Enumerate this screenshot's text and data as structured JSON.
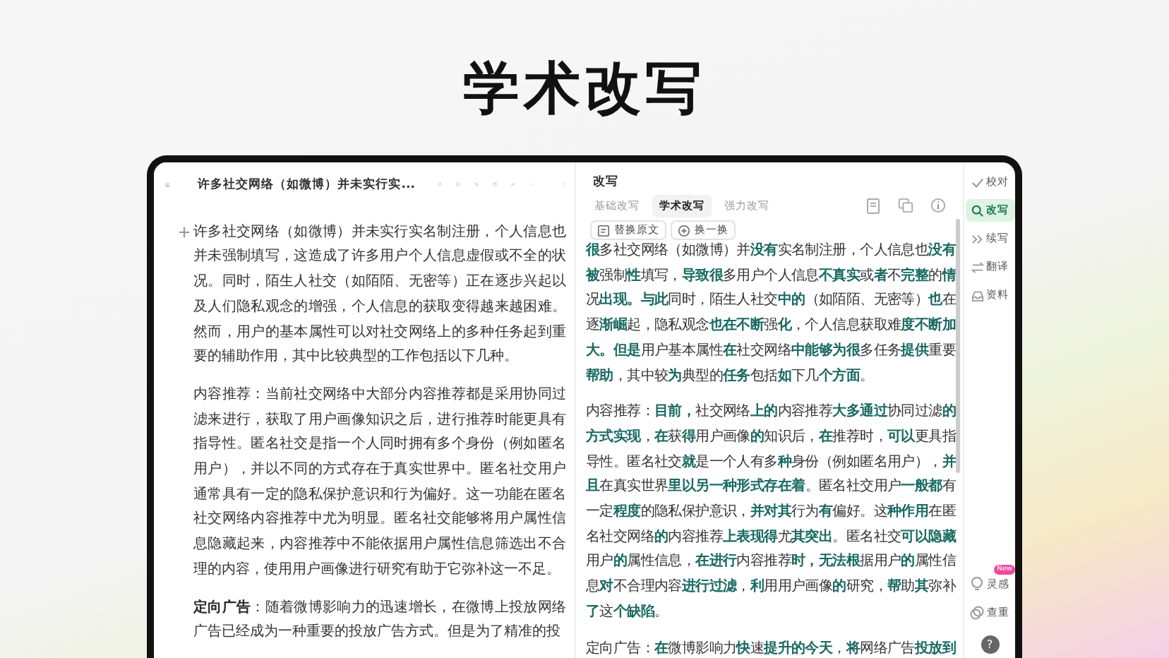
{
  "headline": "学术改写",
  "editor": {
    "doc_title": "许多社交网络（如微博）并未实行实...",
    "paragraphs": [
      "许多社交网络（如微博）并未实行实名制注册，个人信息也并未强制填写，这造成了许多用户个人信息虚假或不全的状况。同时，陌生人社交（如陌陌、无密等）正在逐步兴起以及人们隐私观念的增强，个人信息的获取变得越来越困难。然而，用户的基本属性可以对社交网络上的多种任务起到重要的辅助作用，其中比较典型的工作包括以下几种。",
      "内容推荐：当前社交网络中大部分内容推荐都是采用协同过滤来进行，获取了用户画像知识之后，进行推荐时能更具有指导性。匿名社交是指一个人同时拥有多个身份（例如匿名用户），并以不同的方式存在于真实世界中。匿名社交用户通常具有一定的隐私保护意识和行为偏好。这一功能在匿名社交网络内容推荐中尤为明显。匿名社交能够将用户属性信息隐藏起来，内容推荐中不能依据用户属性信息筛选出不合理的内容，使用用户画像进行研究有助于它弥补这一不足。",
      "**定向广告**：随着微博影响力的迅速增长，在微博上投放网络广告已经成为一种重要的投放广告方式。但是为了精准的投"
    ]
  },
  "rewrite": {
    "title": "改写",
    "tabs": [
      {
        "label": "基础改写",
        "selected": false
      },
      {
        "label": "学术改写",
        "selected": true
      },
      {
        "label": "强力改写",
        "selected": false
      }
    ],
    "actions": [
      "替换原文",
      "换一换"
    ],
    "paragraphs": [
      "**很**多社交网络（如微博）并**没有**实名制注册，个人信息也**没有被**强制**性**填写，**导致很**多用户个人信息**不真实**或**者**不**完整**的**情**况**出现。与此**同时，陌生人社交**中的**（如陌陌、无密等）**也**在逐**渐崛**起，隐私观念**也在不断**强**化**，个人信息获取难**度不断加大。但是**用户基本属性**在**社交网络**中能够为很**多任务**提供**重要**帮助**，其中较**为**典型的**任务**包括**如**下几**个方面**。",
      "内容推荐：**目前，**社交网络**上的**内容推荐**大多通过**协同过滤**的方式实现**，**在**获**得**用户画像**的**知识后，**在**推荐时，**可以**更具指导性。匿名社交**就**是一个人有多**种**身份（例如匿名用户），**并且**在真实世界**里以另一种形式存在着**。匿名社交用户**一般都**有一定**程度**的隐私保护意识，**并对其**行为**有**偏好。这**种作用**在匿名社交网络**的**内容推荐**上表现得**尤**其突出**。匿名社交**可以隐藏**用户**的**属性信息，**在进行**内容推荐**时，无法根**据用户**的**属性信息**对**不合理内容**进行过滤**，**利**用用户画像**的**研究，**帮**助**其**弥补**了**这**个缺陷**。",
      "定向广告：**在**微博影响力**快**速**提升的今天**，**将**网络广告**投放到**"
    ]
  },
  "sidebar": {
    "items": [
      {
        "label": "校对",
        "selected": false
      },
      {
        "label": "改写",
        "selected": true
      },
      {
        "label": "续写",
        "selected": false
      },
      {
        "label": "翻译",
        "selected": false
      },
      {
        "label": "资料",
        "selected": false
      }
    ],
    "bottom": [
      {
        "label": "灵感",
        "badge": "New"
      },
      {
        "label": "查重"
      }
    ],
    "help": "?"
  }
}
